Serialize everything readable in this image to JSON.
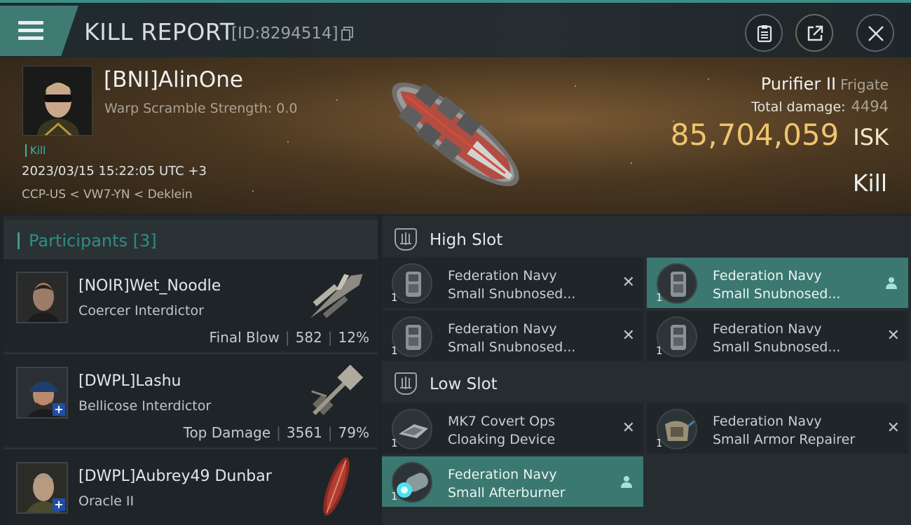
{
  "header": {
    "title": "KILL REPORT",
    "report_id": "[ID:8294514]"
  },
  "victim": {
    "name": "[BNI]AlinOne",
    "warp_scramble": "Warp Scramble Strength: 0.0",
    "kill_tag": "Kill",
    "timestamp": "2023/03/15 15:22:05 UTC +3",
    "location": "CCP-US < VW7-YN < Deklein",
    "ship_name": "Purifier II",
    "ship_class": "Frigate",
    "total_damage_label": "Total damage:",
    "total_damage": "4494",
    "isk_value": "85,704,059",
    "isk_unit": "ISK",
    "result": "Kill"
  },
  "participants": {
    "label": "Participants [3]",
    "rows": [
      {
        "name": "[NOIR]Wet_Noodle",
        "ship": "Coercer Interdictor",
        "role": "Final Blow",
        "damage": "582",
        "percent": "12%"
      },
      {
        "name": "[DWPL]Lashu",
        "ship": "Bellicose Interdictor",
        "role": "Top Damage",
        "damage": "3561",
        "percent": "79%"
      },
      {
        "name": "[DWPL]Aubrey49 Dunbar",
        "ship": "Oracle II"
      }
    ]
  },
  "slots": {
    "high_label": "High Slot",
    "low_label": "Low Slot",
    "high": [
      {
        "name": "Federation Navy\nSmall Snubnosed...",
        "qty": "1",
        "state": "destroyed"
      },
      {
        "name": "Federation Navy\nSmall Snubnosed...",
        "qty": "1",
        "state": "dropped"
      },
      {
        "name": "Federation Navy\nSmall Snubnosed...",
        "qty": "1",
        "state": "destroyed"
      },
      {
        "name": "Federation Navy\nSmall Snubnosed...",
        "qty": "1",
        "state": "destroyed"
      }
    ],
    "low": [
      {
        "name": "MK7 Covert Ops\nCloaking Device",
        "qty": "1",
        "state": "destroyed"
      },
      {
        "name": "Federation Navy\nSmall Armor Repairer",
        "qty": "1",
        "state": "destroyed"
      },
      {
        "name": "Federation Navy\nSmall Afterburner",
        "qty": "1",
        "state": "dropped"
      }
    ]
  },
  "colors": {
    "accent": "#3f7a73",
    "isk": "#f0c46c",
    "dropped_bg": "#3b7871"
  }
}
